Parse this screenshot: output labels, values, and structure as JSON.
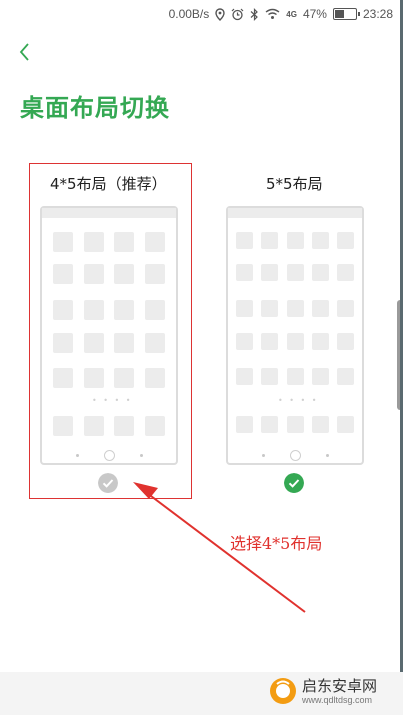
{
  "status_bar": {
    "speed": "0.00B/s",
    "network": "4G",
    "battery": "47%",
    "battery_level": 0.47,
    "time": "23:28"
  },
  "header": {
    "title": "桌面布局切换"
  },
  "layouts": [
    {
      "label": "4*5布局（推荐）",
      "columns": 4,
      "selected": false
    },
    {
      "label": "5*5布局",
      "columns": 5,
      "selected": true
    }
  ],
  "annotation": {
    "text": "选择4*5布局"
  },
  "watermark": {
    "name": "启东安卓网",
    "url": "www.qdltdsg.com"
  },
  "colors": {
    "accent": "#34a853",
    "annotation": "#e0322e",
    "check_unselected": "#c8c8c8",
    "check_selected": "#34a853"
  }
}
